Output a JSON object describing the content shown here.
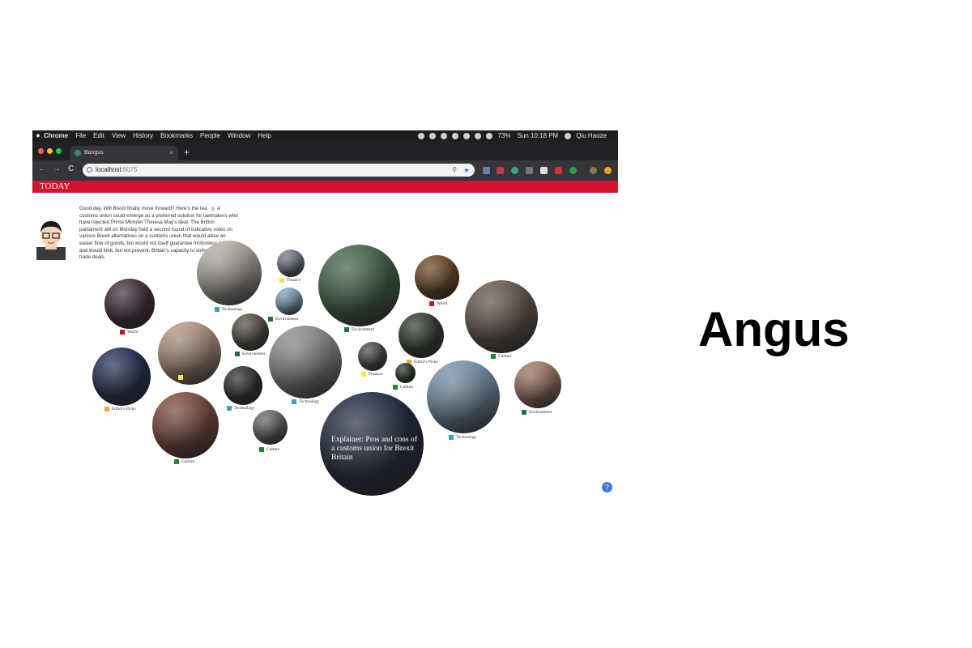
{
  "colors": {
    "today_red": "#d1152f",
    "finance": "#f3e44a",
    "world": "#c8102e",
    "technology": "#3aa0c9",
    "environment": "#1e6e5a",
    "culture": "#1b8a2f",
    "editors_picks": "#f2a53a"
  },
  "menubar": {
    "apple": "",
    "items": [
      "Chrome",
      "File",
      "Edit",
      "View",
      "History",
      "Bookmarks",
      "People",
      "Window",
      "Help"
    ],
    "battery": "73%",
    "clock": "Sun 10:18 PM",
    "user": "Qiu Haoze"
  },
  "tab": {
    "title": "Bangus",
    "close": "×",
    "new_tab": "+"
  },
  "toolbar": {
    "back": "←",
    "forward": "→",
    "reload": "C",
    "url_host": "localhost",
    "url_port": ":6075"
  },
  "site": {
    "masthead": "TODAY"
  },
  "intro": {
    "text": "Good day. Will Brexit finally move forward? Here's the tea. 🍵 A customs union could emerge as a preferred solution for lawmakers who have rejected Prime Minister Theresa May's deal. The British parliament will on Monday hold a second round of indicative votes on various Brexit alternatives on a customs union that would allow an easier flow of goods, but would not itself guarantee frictionless trade and would limit, but not prevent, Britain's capacity to strike its own free trade deals."
  },
  "bubbles": [
    {
      "id": "tech-1",
      "label": "Technology",
      "color": "technology",
      "tone": "#c9c2b8"
    },
    {
      "id": "finance-1",
      "label": "Finance",
      "color": "finance",
      "tone": "#7d8493"
    },
    {
      "id": "env-1",
      "label": "Environment",
      "color": "environment",
      "tone": "#8fb9d9"
    },
    {
      "id": "env-2",
      "label": "Environment",
      "color": "environment",
      "tone": "#3f6b4a"
    },
    {
      "id": "world-1",
      "label": "World",
      "color": "world",
      "tone": "#7a4a1c"
    },
    {
      "id": "world-2",
      "label": "World",
      "color": "world",
      "tone": "#40283a"
    },
    {
      "id": "culture-1",
      "label": "Culture",
      "color": "culture",
      "tone": "#6b5a4e"
    },
    {
      "id": "finance-2",
      "label": "Finance",
      "color": "finance",
      "tone": "#c9a48c"
    },
    {
      "id": "env-3",
      "label": "Environment",
      "color": "environment",
      "tone": "#5a5246"
    },
    {
      "id": "tech-2",
      "label": "Technology",
      "color": "technology",
      "tone": "#9a9a9a"
    },
    {
      "id": "editors-1",
      "label": "Editor's Picks",
      "color": "editors_picks",
      "tone": "#2c3a2a"
    },
    {
      "id": "finance-3",
      "label": "Finance",
      "color": "finance",
      "tone": "#4a4a4a"
    },
    {
      "id": "culture-2",
      "label": "Culture",
      "color": "culture",
      "tone": "#1f3a22"
    },
    {
      "id": "env-4",
      "label": "Environment",
      "color": "environment",
      "tone": "#b5806a"
    },
    {
      "id": "editors-2",
      "label": "Editor's Picks",
      "color": "editors_picks",
      "tone": "#1a2a5a"
    },
    {
      "id": "tech-3",
      "label": "Technology",
      "color": "technology",
      "tone": "#2a2a2a"
    },
    {
      "id": "tech-4",
      "label": "Technology",
      "color": "technology",
      "tone": "#7fa0bf"
    },
    {
      "id": "culture-3",
      "label": "Culture",
      "color": "culture",
      "tone": "#8a4a3a"
    },
    {
      "id": "culture-4",
      "label": "Culture",
      "color": "culture",
      "tone": "#6e6e6e"
    },
    {
      "id": "feature",
      "label": "",
      "color": "technology",
      "tone": "#1a2440"
    }
  ],
  "feature": {
    "headline": "Explainer: Pros and cons of a customs union for Brexit Britain"
  },
  "side_title": "Angus"
}
